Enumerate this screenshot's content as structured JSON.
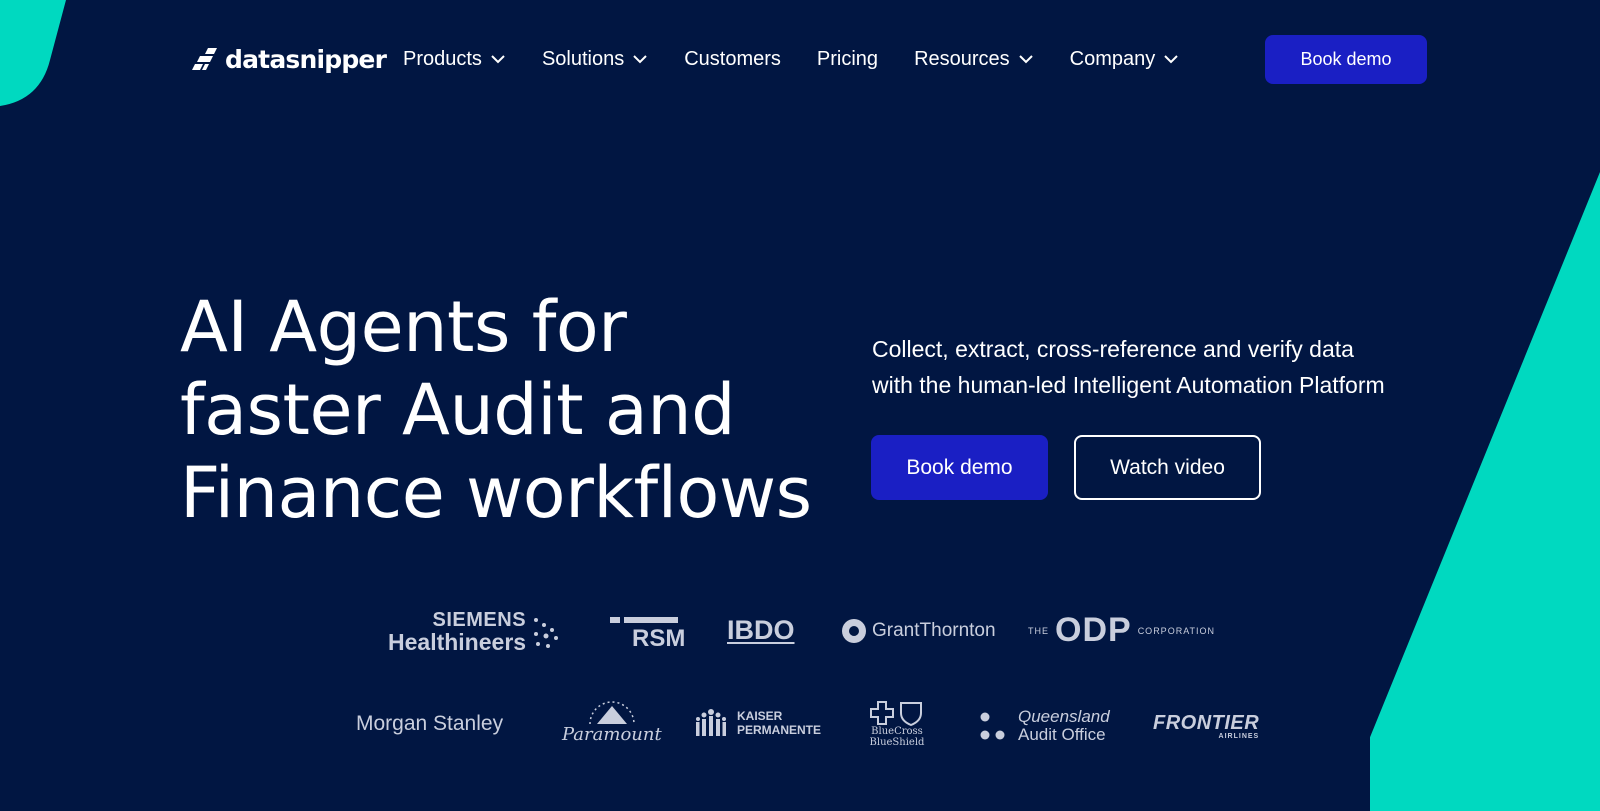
{
  "colors": {
    "background": "#011642",
    "accent_teal": "#00d9c0",
    "button_blue": "#1a1fc4",
    "logo_gray": "#c9cedd"
  },
  "brand": {
    "name": "datasnipper",
    "icon": "datasnipper-logo-icon"
  },
  "nav": {
    "items": [
      {
        "label": "Products",
        "has_dropdown": true
      },
      {
        "label": "Solutions",
        "has_dropdown": true
      },
      {
        "label": "Customers",
        "has_dropdown": false
      },
      {
        "label": "Pricing",
        "has_dropdown": false
      },
      {
        "label": "Resources",
        "has_dropdown": true
      },
      {
        "label": "Company",
        "has_dropdown": true
      }
    ],
    "cta_label": "Book demo"
  },
  "hero": {
    "title_lines": [
      "AI Agents for",
      "faster Audit and",
      "Finance workflows"
    ],
    "subtitle_lines": [
      "Collect, extract, cross-reference and verify data",
      "with the human-led Intelligent Automation Platform"
    ],
    "primary_button": "Book demo",
    "secondary_button": "Watch video"
  },
  "customer_logos": {
    "siemens": {
      "line1": "SIEMENS",
      "line2": "Healthineers"
    },
    "rsm": "RSM",
    "bdo": "IBDO",
    "grant_thornton": "GrantThornton",
    "odp": {
      "prefix": "THE",
      "name": "ODP",
      "suffix": "CORPORATION"
    },
    "morgan_stanley": "Morgan Stanley",
    "paramount": "Paramount",
    "kaiser": {
      "line1": "KAISER",
      "line2": "PERMANENTE"
    },
    "bcbs": {
      "line1": "BlueCross",
      "line2": "BlueShield"
    },
    "qao": {
      "line1": "Queensland",
      "line2": "Audit Office"
    },
    "frontier": {
      "line1": "FRONTIER",
      "line2": "AIRLINES"
    }
  }
}
